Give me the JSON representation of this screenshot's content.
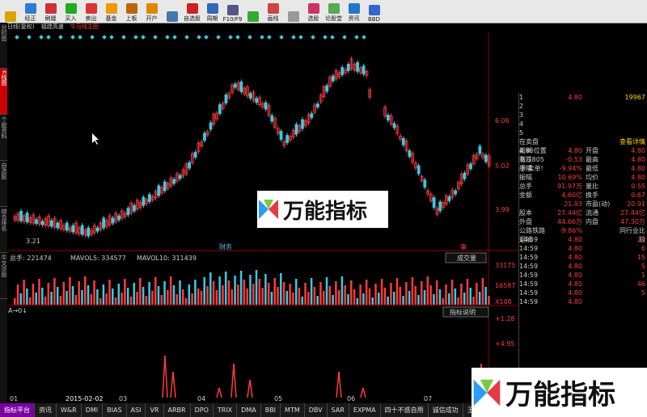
{
  "toolbar": [
    "",
    "经正",
    "刷缝",
    "买入",
    "卖出",
    "基金",
    "上板",
    "开户",
    "",
    "自选股",
    "周期",
    "F10/F9",
    "",
    "画线",
    "",
    "选股",
    "论股堂",
    "资讯",
    "BBD"
  ],
  "topbar": {
    "title": "日线(复权)",
    "name": "福建高速",
    "mode": "牛马线主图"
  },
  "side_tabs": [
    "分时图",
    "K线图",
    "个股资料",
    "自选股",
    "综合排名",
    "牛叉诊股"
  ],
  "labels": {
    "low_price": "3.21",
    "finance": "财务",
    "event": "事",
    "volume_dropdown": "成交量",
    "indicator_btn": "指标说明"
  },
  "volume_bar": {
    "total": "总手: 221474",
    "mavol5": "MAVOL5: 334577",
    "mavol10": "MAVOL10: 311439"
  },
  "right_axis": {
    "p1": "6.06",
    "p2": "5.02",
    "p3": "3.99",
    "v1": "33175",
    "v2": "16587",
    "v3": "X100",
    "i1": "+1.28",
    "i2": "+4.95"
  },
  "dates": [
    "01",
    "2015-02-02",
    "03",
    "04",
    "05",
    "06",
    "07"
  ],
  "quote": {
    "asks": [
      [
        "1",
        "4.80",
        "19967"
      ],
      [
        "2",
        "",
        ""
      ],
      [
        "3",
        "",
        ""
      ],
      [
        "4",
        "",
        ""
      ],
      [
        "5",
        "",
        ""
      ]
    ],
    "ask_side": "买盘",
    "header": "在卖盘4.86位置有  1805手  卖单!",
    "header2": "查看详情",
    "stats": [
      [
        "最新",
        "4.80",
        "开盘",
        "4.80"
      ],
      [
        "涨跌",
        "-0.53",
        "最高",
        "4.80"
      ],
      [
        "涨幅",
        "-9.94%",
        "最低",
        "4.80"
      ],
      [
        "振幅",
        "10.69%",
        "均价",
        "4.80"
      ],
      [
        "总手",
        "91.97万",
        "量比",
        "0.55"
      ],
      [
        "金额",
        "4.60亿",
        "换手",
        "0.67"
      ],
      [
        "",
        "21.93",
        "市盈(动)",
        "20.91"
      ],
      [
        "股本",
        "27.44亿",
        "流通",
        "27.44亿"
      ],
      [
        "外盘",
        "44.66万",
        "内盘",
        "47.30万"
      ]
    ],
    "section": "公路铁路运输",
    "section_pct": "-9.86%",
    "section_link": "同行业比较",
    "trades": [
      [
        "14:59",
        "4.80",
        "23"
      ],
      [
        "14:59",
        "4.80",
        "6"
      ],
      [
        "14:59",
        "4.80",
        "15"
      ],
      [
        "14:59",
        "4.80",
        "5"
      ],
      [
        "14:59",
        "4.80",
        "1"
      ],
      [
        "14:59",
        "4.80",
        "46"
      ],
      [
        "14:59",
        "4.80",
        "5"
      ],
      [
        "14:59",
        "4.80",
        ""
      ]
    ]
  },
  "bottom_tabs": [
    "指标平台",
    "资讯",
    "W&R",
    "DMI",
    "BIAS",
    "ASI",
    "VR",
    "ARBR",
    "DPO",
    "TRIX",
    "DMA",
    "BBI",
    "MTM",
    "DBV",
    "SAR",
    "EXPMA",
    "四十不惑自用",
    "诚信成功",
    "王氏金钻"
  ],
  "logo_text": "万能指标",
  "colors": {
    "up": "#ff3b3b",
    "down": "#3cc8e0",
    "accent": "#ffd700"
  }
}
